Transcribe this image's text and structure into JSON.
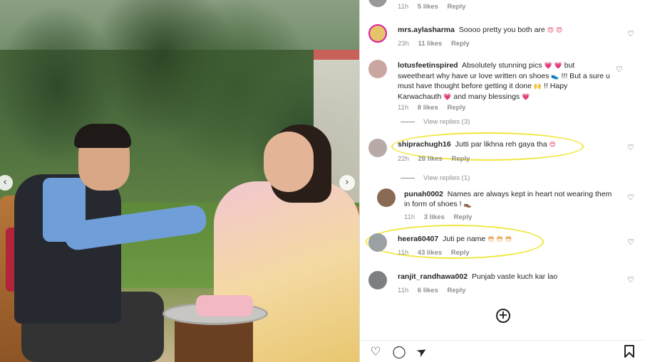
{
  "photo": {
    "prev_icon": "‹",
    "next_icon": "›"
  },
  "top_meta": {
    "time": "11h",
    "likes": "5 likes",
    "reply": "Reply"
  },
  "comments": [
    {
      "username": "mrs.aylasharma",
      "text": "Soooo pretty you both are",
      "emojis": "😍 😍",
      "time": "23h",
      "likes": "11 likes",
      "reply": "Reply",
      "avatar_color": "#e7c36a"
    },
    {
      "username": "lotusfeetinspired",
      "text_1": "Absolutely stunning pics",
      "emojis_1": "💗 💗",
      "text_2": "but sweetheart why have ur love written on shoes",
      "emojis_2": "👟",
      "text_3": "!!! But a sure u must have thought before getting it done",
      "emojis_3": "🙌",
      "text_4": "!! Hapy Karwachauth",
      "emojis_4": "💗",
      "text_5": "and many blessings",
      "emojis_5": "💗",
      "time": "11h",
      "likes": "8 likes",
      "reply": "Reply",
      "view_replies": "View replies (3)",
      "avatar_color": "#c9a7a0"
    },
    {
      "username": "shiprachugh16",
      "text": "Jutti par likhna reh gaya tha",
      "emojis": "😍",
      "time": "22h",
      "likes": "28 likes",
      "reply": "Reply",
      "view_replies": "View replies (1)",
      "avatar_color": "#b8aaa6"
    },
    {
      "username": "punah0002",
      "text": "Names are always kept in heart not wearing them in form of shoes !",
      "emojis": "👞",
      "time": "11h",
      "likes": "3 likes",
      "reply": "Reply",
      "avatar_color": "#8a6a55"
    },
    {
      "username": "heera60407",
      "text": "Juti pe name",
      "emojis": "😳 😳 😳",
      "time": "11h",
      "likes": "43 likes",
      "reply": "Reply",
      "avatar_color": "#9aa0a4"
    },
    {
      "username": "ranjit_randhawa002",
      "text": "Punjab vaste kuch kar lao",
      "time": "11h",
      "likes": "6 likes",
      "reply": "Reply",
      "avatar_color": "#7d7f80"
    }
  ],
  "icons": {
    "heart": "♡",
    "add": "+",
    "like": "♡",
    "comment": "◯",
    "share": "➤",
    "save": "🔖"
  },
  "colors": {
    "highlight": "#f1e63a",
    "heart_emoji": "#e5395a"
  }
}
